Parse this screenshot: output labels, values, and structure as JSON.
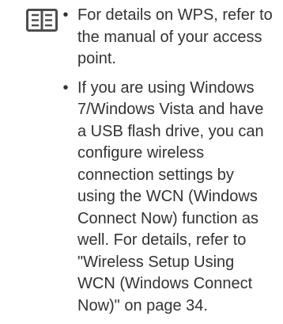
{
  "note": {
    "icon": "manual-book-icon",
    "items": [
      {
        "bullet": "•",
        "text": "For details on WPS, refer to the manual of your access point."
      },
      {
        "bullet": "•",
        "text": "If you are using Windows 7/Windows Vista and have a USB flash drive, you can configure wireless connection settings by using the WCN (Windows Connect Now) function as well. For details, refer to \"Wireless Setup Using WCN (Windows Connect Now)\" on page 34."
      }
    ]
  }
}
